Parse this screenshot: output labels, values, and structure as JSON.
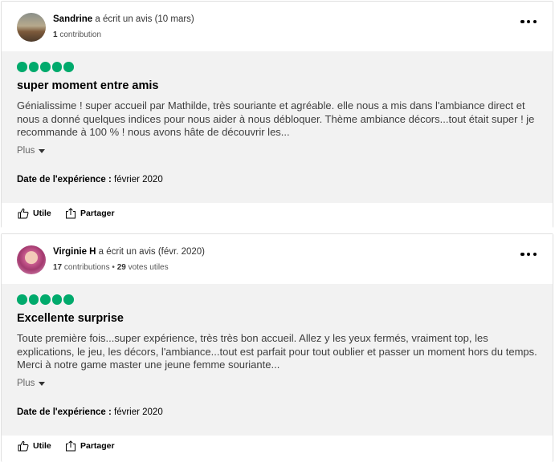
{
  "reviews": [
    {
      "author": "Sandrine",
      "wrote_label": "a écrit un avis (10 mars)",
      "contributions": "1",
      "contributions_label": "contribution",
      "helpful_votes": "",
      "helpful_votes_label": "",
      "rating": 5,
      "title": "super moment entre amis",
      "text": "Génialissime ! super accueil par Mathilde, très souriante et agréable. elle nous a mis dans l'ambiance direct et nous a donné quelques indices pour nous aider à nous débloquer. Thème ambiance décors...tout était super ! je recommande à 100 % ! nous avons hâte de découvrir les...",
      "more_label": "Plus",
      "experience_label": "Date de l'expérience :",
      "experience_date": "février 2020",
      "helpful_label": "Utile",
      "share_label": "Partager"
    },
    {
      "author": "Virginie H",
      "wrote_label": "a écrit un avis (févr. 2020)",
      "contributions": "17",
      "contributions_label": "contributions",
      "helpful_votes": "29",
      "helpful_votes_label": "votes utiles",
      "rating": 5,
      "title": "Excellente surprise",
      "text": "Toute première fois...super expérience, très très bon accueil. Allez y les yeux fermés, vraiment top, les explications, le jeu, les décors, l'ambiance...tout est parfait pour tout oublier et passer un moment hors du temps. Merci à notre game master une jeune femme souriante...",
      "more_label": "Plus",
      "experience_label": "Date de l'expérience :",
      "experience_date": "février 2020",
      "helpful_label": "Utile",
      "share_label": "Partager"
    }
  ],
  "colors": {
    "rating_bubble": "#00aa6c",
    "body_background": "#f2f2f2"
  },
  "icons": {
    "more": "more-options-icon",
    "helpful": "thumbs-up-icon",
    "share": "share-icon",
    "more_caret": "caret-down-icon"
  }
}
